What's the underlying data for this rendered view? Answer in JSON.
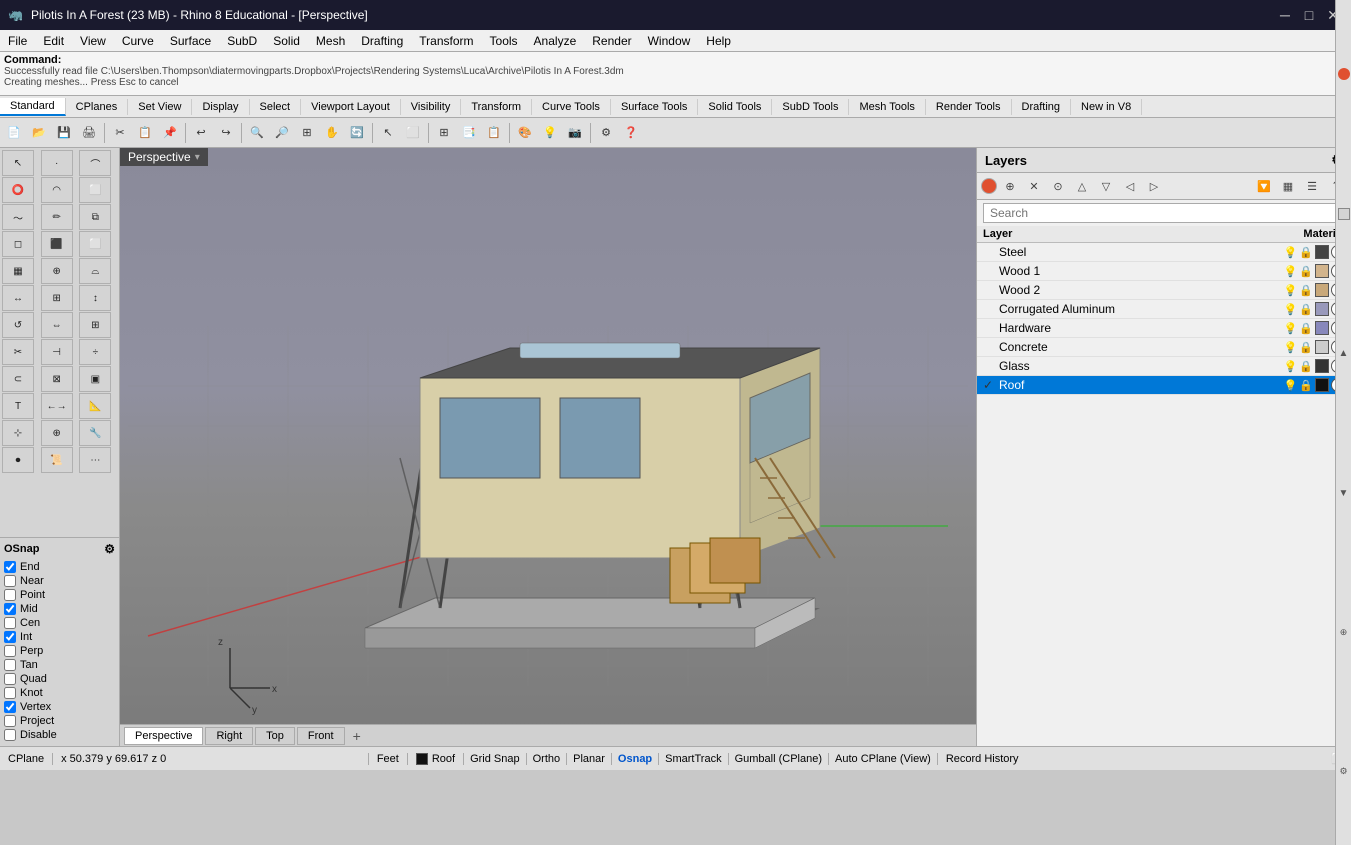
{
  "titlebar": {
    "icon": "🦏",
    "title": "Pilotis In A Forest (23 MB) - Rhino 8 Educational - [Perspective]",
    "min": "─",
    "max": "□",
    "close": "✕"
  },
  "menubar": {
    "items": [
      "File",
      "Edit",
      "View",
      "Curve",
      "Surface",
      "SubD",
      "Solid",
      "Mesh",
      "Drafting",
      "Transform",
      "Tools",
      "Analyze",
      "Render",
      "Window",
      "Help"
    ]
  },
  "commandbar": {
    "label": "Command:",
    "line1": "Successfully read file C:\\Users\\ben.Thompson\\diatermovingparts.Dropbox\\Projects\\Rendering Systems\\Luca\\Archive\\Pilotis In A Forest.3dm",
    "line2": "Creating meshes... Press Esc to cancel"
  },
  "tabtoolbar": {
    "tabs": [
      "Standard",
      "CPlanes",
      "Set View",
      "Display",
      "Select",
      "Viewport Layout",
      "Visibility",
      "Transform",
      "Curve Tools",
      "Surface Tools",
      "Solid Tools",
      "SubD Tools",
      "Mesh Tools",
      "Render Tools",
      "Drafting",
      "New in V8"
    ]
  },
  "viewport": {
    "label": "Perspective",
    "dropdown": "▾"
  },
  "viewport_tabs": {
    "tabs": [
      "Perspective",
      "Right",
      "Top",
      "Front"
    ],
    "add": "+"
  },
  "layers": {
    "title": "Layers",
    "search_placeholder": "Search",
    "columns": {
      "layer": "Layer",
      "material": "Material"
    },
    "items": [
      {
        "name": "Steel",
        "checked": false,
        "active": false,
        "bulb": "💡",
        "lock": "🔒",
        "color": "#444444",
        "mat": "⭕"
      },
      {
        "name": "Wood 1",
        "checked": false,
        "active": false,
        "bulb": "💡",
        "lock": "🔒",
        "color": "#d2b48c",
        "mat": "⭕"
      },
      {
        "name": "Wood 2",
        "checked": false,
        "active": false,
        "bulb": "💡",
        "lock": "🔒",
        "color": "#c8a87a",
        "mat": "⭕"
      },
      {
        "name": "Corrugated Aluminum",
        "checked": false,
        "active": false,
        "bulb": "💡",
        "lock": "🔒",
        "color": "#9999bb",
        "mat": "⭕"
      },
      {
        "name": "Hardware",
        "checked": false,
        "active": false,
        "bulb": "💡",
        "lock": "🔒",
        "color": "#8888bb",
        "mat": "⭕"
      },
      {
        "name": "Concrete",
        "checked": false,
        "active": false,
        "bulb": "💡",
        "lock": "🔒",
        "color": "#cccccc",
        "mat": "⭕"
      },
      {
        "name": "Glass",
        "checked": false,
        "active": false,
        "bulb": "💡",
        "lock": "🔒",
        "color": "#333333",
        "mat": "⭕"
      },
      {
        "name": "Roof",
        "checked": true,
        "active": true,
        "bulb": "",
        "lock": "",
        "color": "#111111",
        "mat": "⭕"
      }
    ]
  },
  "osnap": {
    "title": "OSnap",
    "items": [
      {
        "label": "End",
        "checked": true
      },
      {
        "label": "Near",
        "checked": false
      },
      {
        "label": "Point",
        "checked": false
      },
      {
        "label": "Mid",
        "checked": true
      },
      {
        "label": "Cen",
        "checked": false
      },
      {
        "label": "Int",
        "checked": true
      },
      {
        "label": "Perp",
        "checked": false
      },
      {
        "label": "Tan",
        "checked": false
      },
      {
        "label": "Quad",
        "checked": false
      },
      {
        "label": "Knot",
        "checked": false
      },
      {
        "label": "Vertex",
        "checked": true
      },
      {
        "label": "Project",
        "checked": false
      },
      {
        "label": "Disable",
        "checked": false
      }
    ]
  },
  "statusbar": {
    "cplane": "CPlane",
    "coords": "x 50.379  y 69.617  z 0",
    "units": "Feet",
    "layer_color": "#111111",
    "layer_name": "Roof",
    "grid_snap": "Grid Snap",
    "ortho": "Ortho",
    "planar": "Planar",
    "osnap": "Osnap",
    "smart_track": "SmartTrack",
    "gumball": "Gumball (CPlane)",
    "auto_cplane": "Auto CPlane (View)",
    "record_history": "Record History"
  },
  "toolbar_icons": {
    "file": [
      "📂",
      "💾",
      "🖨",
      "",
      "✂",
      "📋",
      "",
      "↩",
      "↪",
      "",
      "🔍",
      "🔍",
      "🔍",
      "🔍",
      "🔍",
      "",
      "⬜",
      "",
      "",
      "",
      "",
      "",
      "",
      "",
      ""
    ],
    "tools": [
      "🖊",
      "📐",
      "⬜",
      "⭕",
      "🔺",
      "◯",
      "📏",
      "📐",
      "",
      "🔧",
      "⚙"
    ]
  },
  "layer_toolbar_icons": [
    "⊕",
    "📋",
    "✕",
    "⊙",
    "△",
    "▽",
    "◁",
    "▷",
    "🔽",
    "≡",
    "☰",
    "?"
  ]
}
